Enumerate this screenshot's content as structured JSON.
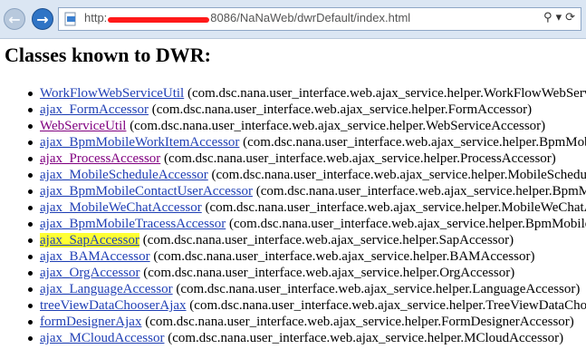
{
  "browser": {
    "url_start": "http:",
    "url_end": "8086/NaNaWeb/dwrDefault/index.html"
  },
  "page": {
    "title": "Classes known to DWR:"
  },
  "classes": [
    {
      "name": "WorkFlowWebServiceUtil",
      "pkg": " (com.dsc.nana.user_interface.web.ajax_service.helper.WorkFlowWebServiceUtil)",
      "visited": false
    },
    {
      "name": "ajax_FormAccessor",
      "pkg": " (com.dsc.nana.user_interface.web.ajax_service.helper.FormAccessor)",
      "visited": false
    },
    {
      "name": "WebServiceUtil",
      "pkg": " (com.dsc.nana.user_interface.web.ajax_service.helper.WebServiceAccessor)",
      "visited": true
    },
    {
      "name": "ajax_BpmMobileWorkItemAccessor",
      "pkg": " (com.dsc.nana.user_interface.web.ajax_service.helper.BpmMobileWorkItemAccessor)",
      "visited": false
    },
    {
      "name": "ajax_ProcessAccessor",
      "pkg": " (com.dsc.nana.user_interface.web.ajax_service.helper.ProcessAccessor)",
      "visited": true
    },
    {
      "name": "ajax_MobileScheduleAccessor",
      "pkg": " (com.dsc.nana.user_interface.web.ajax_service.helper.MobileScheduleAccessor)",
      "visited": false
    },
    {
      "name": "ajax_BpmMobileContactUserAccessor",
      "pkg": " (com.dsc.nana.user_interface.web.ajax_service.helper.BpmMobileContactUserAccessor)",
      "visited": false
    },
    {
      "name": "ajax_MobileWeChatAccessor",
      "pkg": " (com.dsc.nana.user_interface.web.ajax_service.helper.MobileWeChatAccessor)",
      "visited": false
    },
    {
      "name": "ajax_BpmMobileTracessAccessor",
      "pkg": " (com.dsc.nana.user_interface.web.ajax_service.helper.BpmMobileTracessAccessor)",
      "visited": false
    },
    {
      "name": "ajax_SapAccessor",
      "pkg": " (com.dsc.nana.user_interface.web.ajax_service.helper.SapAccessor)",
      "visited": false,
      "highlight": true
    },
    {
      "name": "ajax_BAMAccessor",
      "pkg": " (com.dsc.nana.user_interface.web.ajax_service.helper.BAMAccessor)",
      "visited": false
    },
    {
      "name": "ajax_OrgAccessor",
      "pkg": " (com.dsc.nana.user_interface.web.ajax_service.helper.OrgAccessor)",
      "visited": false
    },
    {
      "name": "ajax_LanguageAccessor",
      "pkg": " (com.dsc.nana.user_interface.web.ajax_service.helper.LanguageAccessor)",
      "visited": false
    },
    {
      "name": "treeViewDataChooserAjax",
      "pkg": " (com.dsc.nana.user_interface.web.ajax_service.helper.TreeViewDataChooserAjax)",
      "visited": false
    },
    {
      "name": "formDesignerAjax",
      "pkg": " (com.dsc.nana.user_interface.web.ajax_service.helper.FormDesignerAccessor)",
      "visited": false
    },
    {
      "name": "ajax_MCloudAccessor",
      "pkg": " (com.dsc.nana.user_interface.web.ajax_service.helper.MCloudAccessor)",
      "visited": false
    }
  ],
  "colors": {
    "link": "#1f3fb5",
    "visited": "#800080",
    "highlight": "#ffff33",
    "redaction": "#ff1a1a"
  }
}
